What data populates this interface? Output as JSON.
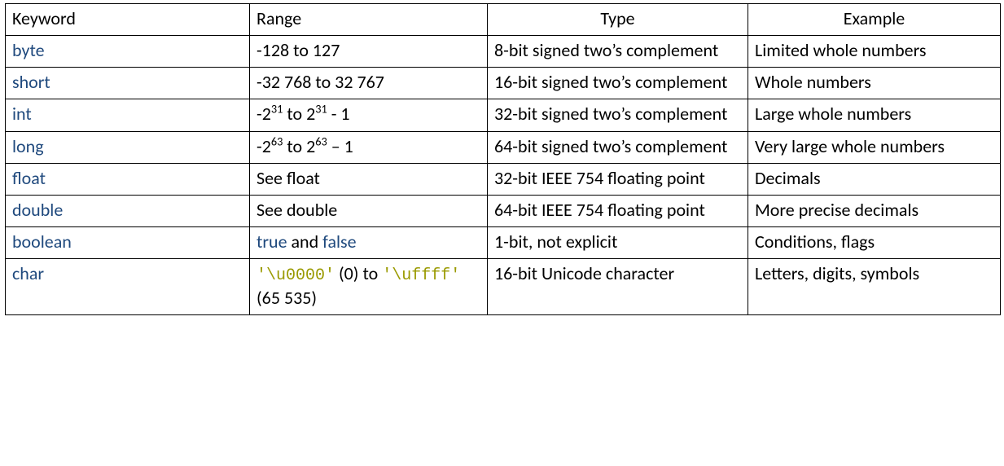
{
  "headers": {
    "keyword": "Keyword",
    "range": "Range",
    "type": "Type",
    "example": "Example"
  },
  "rows": {
    "byte": {
      "keyword": "byte",
      "range_plain": "-128 to 127",
      "type": "8-bit signed two’s complement",
      "example": "Limited whole numbers"
    },
    "short": {
      "keyword": "short",
      "range_plain": "-32 768 to 32 767",
      "type": "16-bit signed two’s complement",
      "example": "Whole numbers"
    },
    "int": {
      "keyword": "int",
      "range_prefix": "-2",
      "range_exp1": "31",
      "range_mid": " to 2",
      "range_exp2": "31",
      "range_suffix": " - 1",
      "type": "32-bit signed two’s complement",
      "example": "Large whole numbers"
    },
    "long": {
      "keyword": "long",
      "range_prefix": "-2",
      "range_exp1": "63",
      "range_mid": " to 2",
      "range_exp2": "63",
      "range_suffix": " – 1",
      "type": "64-bit signed two’s complement",
      "example": "Very large whole numbers"
    },
    "float": {
      "keyword": "float",
      "range_plain": "See float",
      "type": "32-bit IEEE 754 floating point",
      "example": "Decimals"
    },
    "double": {
      "keyword": "double",
      "range_plain": "See double",
      "type": "64-bit IEEE 754 floating point",
      "example": "More precise decimals"
    },
    "boolean": {
      "keyword": "boolean",
      "range_true": "true",
      "range_and": " and ",
      "range_false": "false",
      "type": "1-bit, not explicit",
      "example": "Conditions, flags"
    },
    "char": {
      "keyword": "char",
      "range_code1": "'\\u0000'",
      "range_text1": " (0) to ",
      "range_code2": "'\\uffff'",
      "range_text2": " (65 535)",
      "type": "16-bit Unicode character",
      "example": "Letters, digits, symbols"
    }
  }
}
